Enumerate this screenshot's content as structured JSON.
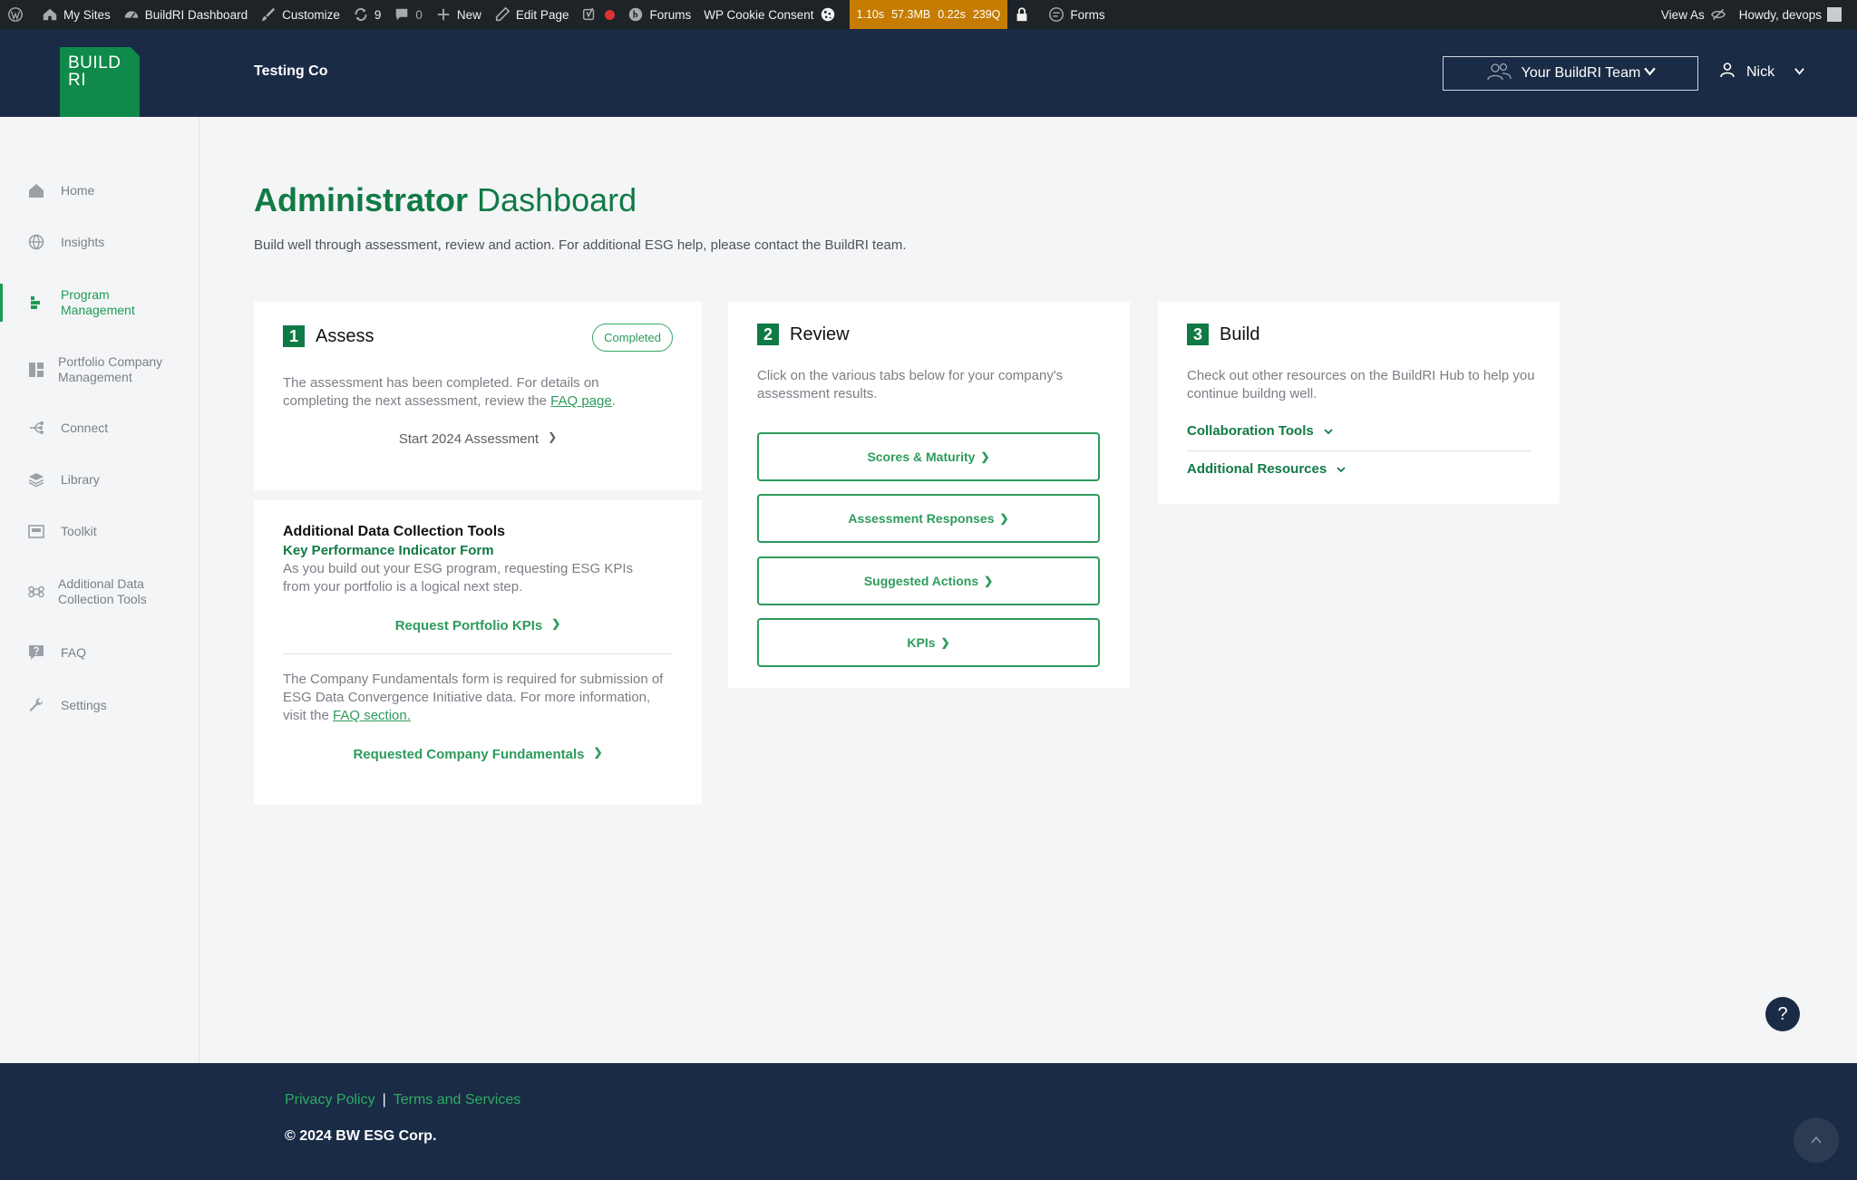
{
  "adminbar": {
    "my_sites": "My Sites",
    "dashboard": "BuildRI Dashboard",
    "customize": "Customize",
    "updates_count": "9",
    "comments_count": "0",
    "new": "New",
    "edit_page": "Edit Page",
    "forums": "Forums",
    "cookie_consent": "WP Cookie Consent",
    "metrics": [
      "1.10s",
      "57.3MB",
      "0.22s",
      "239Q"
    ],
    "forms": "Forms",
    "view_as": "View As",
    "howdy": "Howdy, devops"
  },
  "header": {
    "logo_line1": "BUILD",
    "logo_line2": "RI",
    "company": "Testing Co",
    "team_button": "Your BuildRI Team",
    "user_name": "Nick"
  },
  "sidebar": {
    "items": [
      {
        "label": "Home"
      },
      {
        "label": "Insights"
      },
      {
        "label": "Program Management"
      },
      {
        "label": "Portfolio Company Management"
      },
      {
        "label": "Connect"
      },
      {
        "label": "Library"
      },
      {
        "label": "Toolkit"
      },
      {
        "label": "Additional Data Collection Tools"
      },
      {
        "label": "FAQ"
      },
      {
        "label": "Settings"
      }
    ]
  },
  "main": {
    "title_bold": "Administrator",
    "title_light": "Dashboard",
    "subtitle": "Build well through assessment, review and action. For additional ESG help, please contact the BuildRI team."
  },
  "assess": {
    "num": "1",
    "title": "Assess",
    "badge": "Completed",
    "text_before": "The assessment has been completed. For details on completing the next assessment, review the ",
    "faq_link": "FAQ page",
    "text_after": ".",
    "start_link": "Start 2024 Assessment"
  },
  "adct": {
    "title": "Additional Data Collection Tools",
    "kpi_title": "Key Performance Indicator Form",
    "kpi_text": "As you build out your ESG program, requesting ESG KPIs from your portfolio is a logical next step.",
    "kpi_link": "Request Portfolio KPIs",
    "fund_text": "The Company Fundamentals form is required for submission of ESG Data Convergence Initiative data. For more information, visit the ",
    "fund_faq_link": "FAQ section.",
    "fund_link": "Requested Company Fundamentals"
  },
  "review": {
    "num": "2",
    "title": "Review",
    "text": "Click on the various tabs below for your company's assessment results.",
    "buttons": [
      "Scores & Maturity",
      "Assessment Responses",
      "Suggested Actions",
      "KPIs"
    ]
  },
  "build": {
    "num": "3",
    "title": "Build",
    "text": "Check out other resources on the BuildRI Hub to help you continue buildng well.",
    "acc1": "Collaboration Tools",
    "acc2": "Additional Resources"
  },
  "help": "?",
  "footer": {
    "privacy": "Privacy Policy",
    "separator": "|",
    "terms": "Terms and Services",
    "copyright": "© 2024 BW ESG Corp."
  },
  "colors": {
    "brand_green": "#0f8a4a",
    "accent_green": "#2d9b5c",
    "navy": "#1a2b45"
  }
}
